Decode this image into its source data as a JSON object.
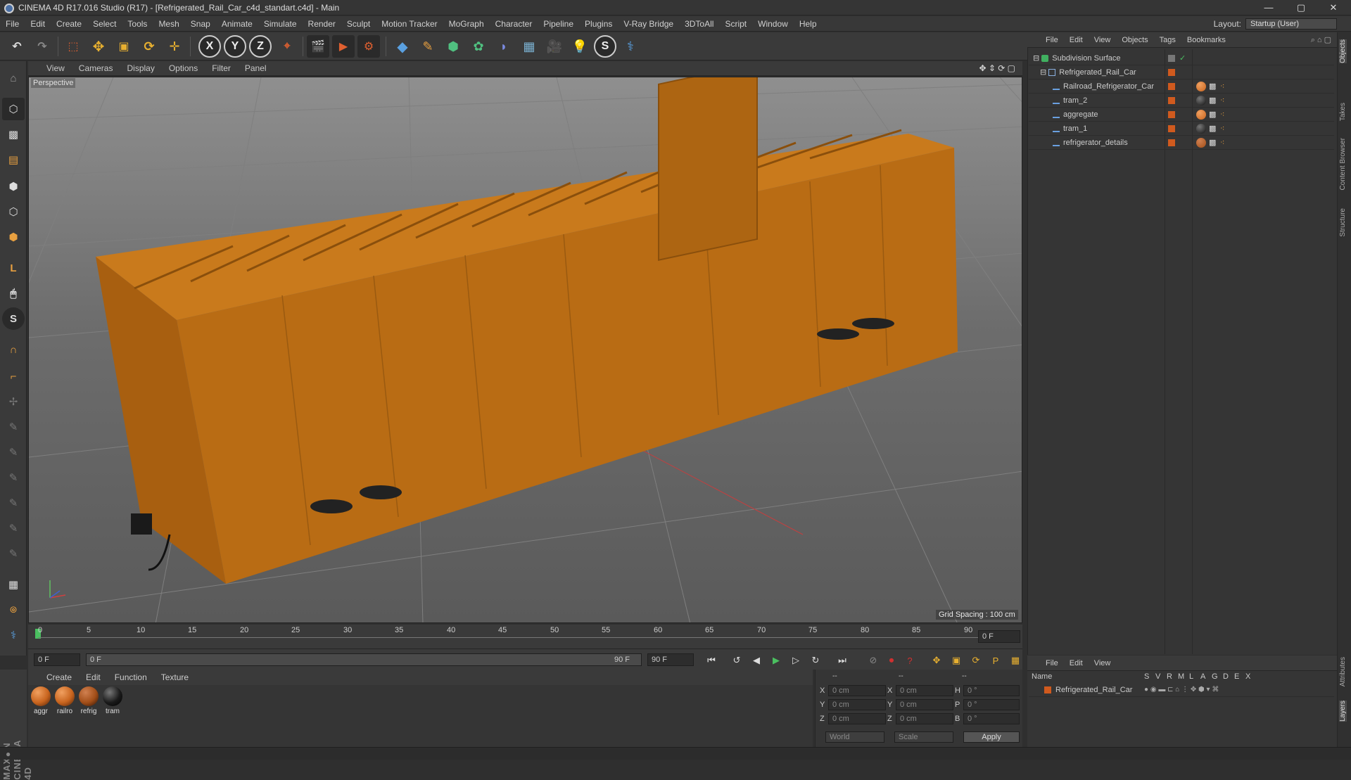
{
  "window": {
    "title": "CINEMA 4D R17.016 Studio (R17) - [Refrigerated_Rail_Car_c4d_standart.c4d] - Main",
    "minimize": "—",
    "maximize": "▢",
    "close": "✕"
  },
  "menubar": {
    "items": [
      "File",
      "Edit",
      "Create",
      "Select",
      "Tools",
      "Mesh",
      "Snap",
      "Animate",
      "Simulate",
      "Render",
      "Sculpt",
      "Motion Tracker",
      "MoGraph",
      "Character",
      "Pipeline",
      "Plugins",
      "V-Ray Bridge",
      "3DToAll",
      "Script",
      "Window",
      "Help"
    ],
    "layout_label": "Layout:",
    "layout_value": "Startup (User)"
  },
  "toolbar": {
    "axis_x": "X",
    "axis_y": "Y",
    "axis_z": "Z"
  },
  "viewport": {
    "menu": [
      "View",
      "Cameras",
      "Display",
      "Options",
      "Filter",
      "Panel"
    ],
    "camera_label": "Perspective",
    "grid_spacing": "Grid Spacing : 100 cm"
  },
  "timeline": {
    "ticks": [
      "0",
      "5",
      "10",
      "15",
      "20",
      "25",
      "30",
      "35",
      "40",
      "45",
      "50",
      "55",
      "60",
      "65",
      "70",
      "75",
      "80",
      "85",
      "90"
    ],
    "current_frame_right": "0 F",
    "start_field": "0 F",
    "range_start": "0 F",
    "range_end": "90 F",
    "end_field": "90 F"
  },
  "materials": {
    "menu": [
      "Create",
      "Edit",
      "Function",
      "Texture"
    ],
    "items": [
      {
        "label": "aggr",
        "color": "#c8641e"
      },
      {
        "label": "railro",
        "color": "#c8641e"
      },
      {
        "label": "refrig",
        "color": "#a24e18"
      },
      {
        "label": "tram",
        "color": "#1a1a1a"
      }
    ]
  },
  "coords": {
    "header_a": "--",
    "header_b": "--",
    "header_c": "--",
    "x_label": "X",
    "x_value": "0 cm",
    "y_label": "Y",
    "y_value": "0 cm",
    "z_label": "Z",
    "z_value": "0 cm",
    "x2_label": "X",
    "x2_value": "0 cm",
    "y2_label": "Y",
    "y2_value": "0 cm",
    "z2_label": "Z",
    "z2_value": "0 cm",
    "h_label": "H",
    "h_value": "0 °",
    "p_label": "P",
    "p_value": "0 °",
    "b_label": "B",
    "b_value": "0 °",
    "world": "World",
    "scale": "Scale",
    "apply": "Apply"
  },
  "objects": {
    "menu": [
      "File",
      "Edit",
      "View",
      "Objects",
      "Tags",
      "Bookmarks"
    ],
    "tree": [
      {
        "name": "Subdivision Surface",
        "indent": 0
      },
      {
        "name": "Refrigerated_Rail_Car",
        "indent": 1
      },
      {
        "name": "Railroad_Refrigerator_Car",
        "indent": 2
      },
      {
        "name": "tram_2",
        "indent": 2
      },
      {
        "name": "aggregate",
        "indent": 2
      },
      {
        "name": "tram_1",
        "indent": 2
      },
      {
        "name": "refrigerator_details",
        "indent": 2
      }
    ]
  },
  "layers": {
    "menu": [
      "File",
      "Edit",
      "View"
    ],
    "col_name": "Name",
    "cols": [
      "S",
      "V",
      "R",
      "M",
      "L",
      "A",
      "G",
      "D",
      "E",
      "X"
    ],
    "row_name": "Refrigerated_Rail_Car"
  },
  "side_tabs": [
    "Objects",
    "Takes",
    "Content Browser",
    "Structure",
    "Attributes",
    "Layers"
  ],
  "brand": "MAXON CINEMA 4D"
}
